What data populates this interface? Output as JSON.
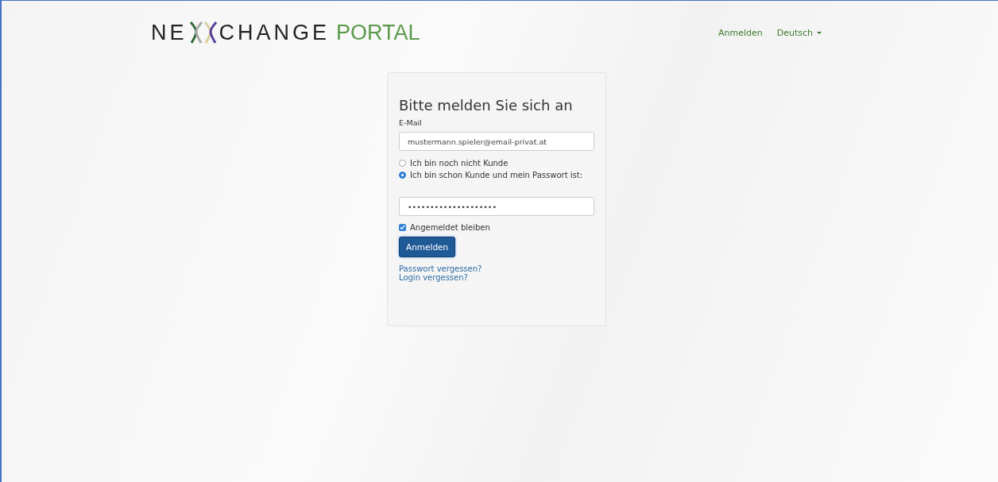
{
  "header": {
    "logo": {
      "left": "NE",
      "middle": "CHANGE",
      "right": "PORTAL"
    },
    "nav": [
      {
        "label": "Anmelden",
        "kind": "link"
      },
      {
        "label": "Deutsch",
        "kind": "dropdown"
      }
    ]
  },
  "login": {
    "title": "Bitte melden Sie sich an",
    "email_label": "E-Mail",
    "email": "mustermann.spieler@email-privat.at",
    "options": [
      {
        "label": "Ich bin noch nicht Kunde",
        "selected": false
      },
      {
        "label": "Ich bin schon Kunde und mein Passwort ist:",
        "selected": true
      }
    ],
    "password": "••••••••••••••••••••",
    "remember": {
      "label": "Angemeldet bleiben",
      "checked": true
    },
    "button": "Anmelden",
    "links": [
      "Passwort vergessen?",
      "Login vergessen?"
    ]
  }
}
